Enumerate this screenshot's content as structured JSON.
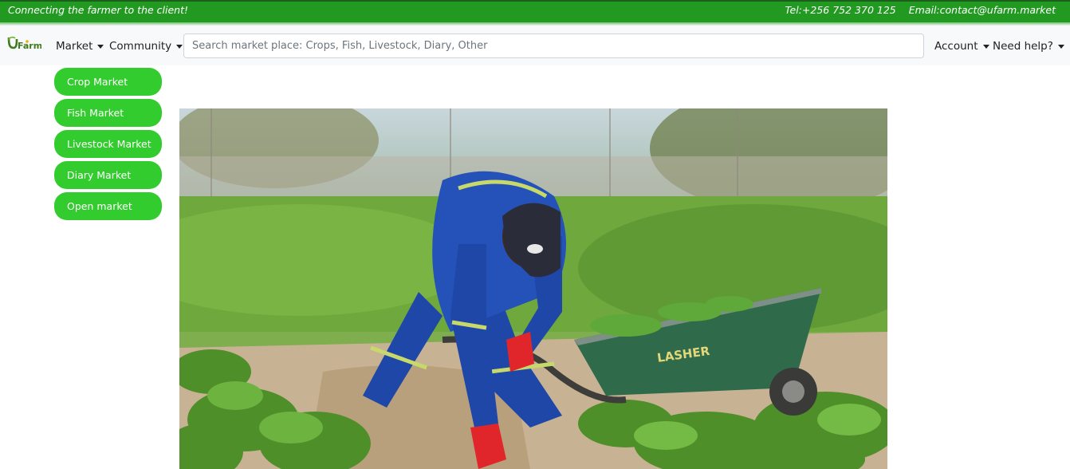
{
  "topbar": {
    "tagline": "Connecting the farmer to the client!",
    "tel": "Tel:+256 752 370 125",
    "email": "Email:contact@ufarm.market"
  },
  "brand": {
    "logo_text": "UFarm"
  },
  "nav": {
    "market": "Market",
    "community": "Community",
    "account": "Account",
    "help": "Need help?"
  },
  "search": {
    "placeholder": "Search market place: Crops, Fish, Livestock, Diary, Other",
    "value": ""
  },
  "sidebar": {
    "items": [
      {
        "label": "Crop Market"
      },
      {
        "label": "Fish Market"
      },
      {
        "label": "Livestock Market"
      },
      {
        "label": "Diary Market"
      },
      {
        "label": "Open market"
      }
    ]
  },
  "hero": {
    "wheelbarrow_text": "LASHER",
    "colors": {
      "grass": "#6fa83c",
      "soil": "#c8b294",
      "overalls": "#1f47a8",
      "barrow": "#2f6b4a",
      "gloves": "#e0262b"
    }
  },
  "colors": {
    "brand_green": "#229a22",
    "button_green": "#33cc2e"
  }
}
